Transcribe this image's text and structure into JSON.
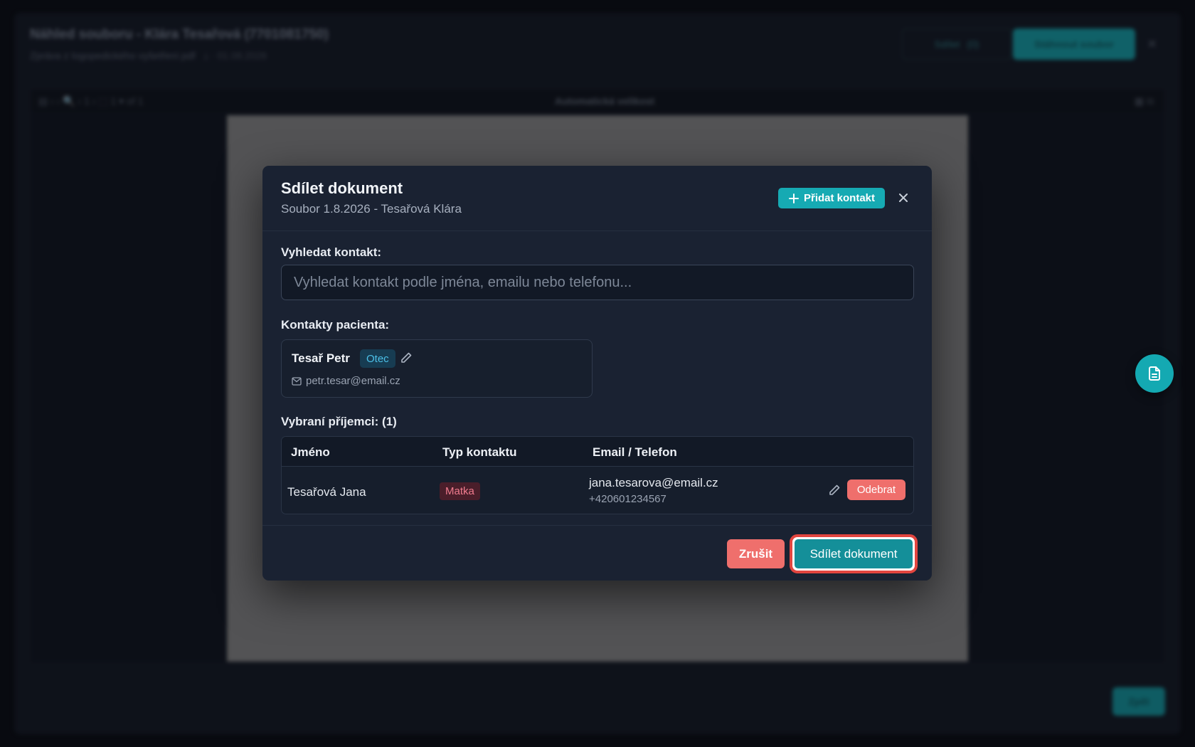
{
  "background": {
    "title": "Náhled souboru - Klára Tesařová (7701081750)",
    "subtitle": "Zpráva z logopedického vyšetření.pdf",
    "subtitle_meta": "⤓ · 01.08.2026",
    "btn_outline_label": "Sdílet",
    "btn_outline_count": "(0)",
    "btn_primary_label": "Stáhnout soubor",
    "toolbar_left": "▤  ‹ ›  🔍  ‹ 1 › ⬚ 1 ▾ of 1",
    "toolbar_center": "Automatická velikost",
    "toolbar_right": "▦  ⧉",
    "footer_btn_label": "Zpět"
  },
  "modal": {
    "title": "Sdílet dokument",
    "subtitle": "Soubor 1.8.2026 - Tesařová Klára",
    "add_contact_label": "Přidat kontakt",
    "search_label": "Vyhledat kontakt:",
    "search_placeholder": "Vyhledat kontakt podle jména, emailu nebo telefonu...",
    "patient_contacts_label": "Kontakty pacienta:",
    "contacts": [
      {
        "name": "Tesař Petr",
        "relation": "Otec",
        "email": "petr.tesar@email.cz"
      }
    ],
    "recipients_label": "Vybraní příjemci: (1)",
    "table": {
      "headers": [
        "Jméno",
        "Typ kontaktu",
        "Email / Telefon"
      ],
      "rows": [
        {
          "name": "Tesařová Jana",
          "type": "Matka",
          "email": "jana.tesarova@email.cz",
          "phone": "+420601234567",
          "remove_label": "Odebrat"
        }
      ]
    },
    "cancel_label": "Zrušit",
    "share_label": "Sdílet dokument"
  },
  "colors": {
    "accent": "#16aab3",
    "danger": "#ef6f6c",
    "highlight_ring": "#e2453f",
    "modal_bg": "#1a2232"
  },
  "icons": {
    "add": "plus-icon",
    "close": "close-icon",
    "edit": "pencil-icon",
    "email": "envelope-icon",
    "fab": "document-icon"
  }
}
